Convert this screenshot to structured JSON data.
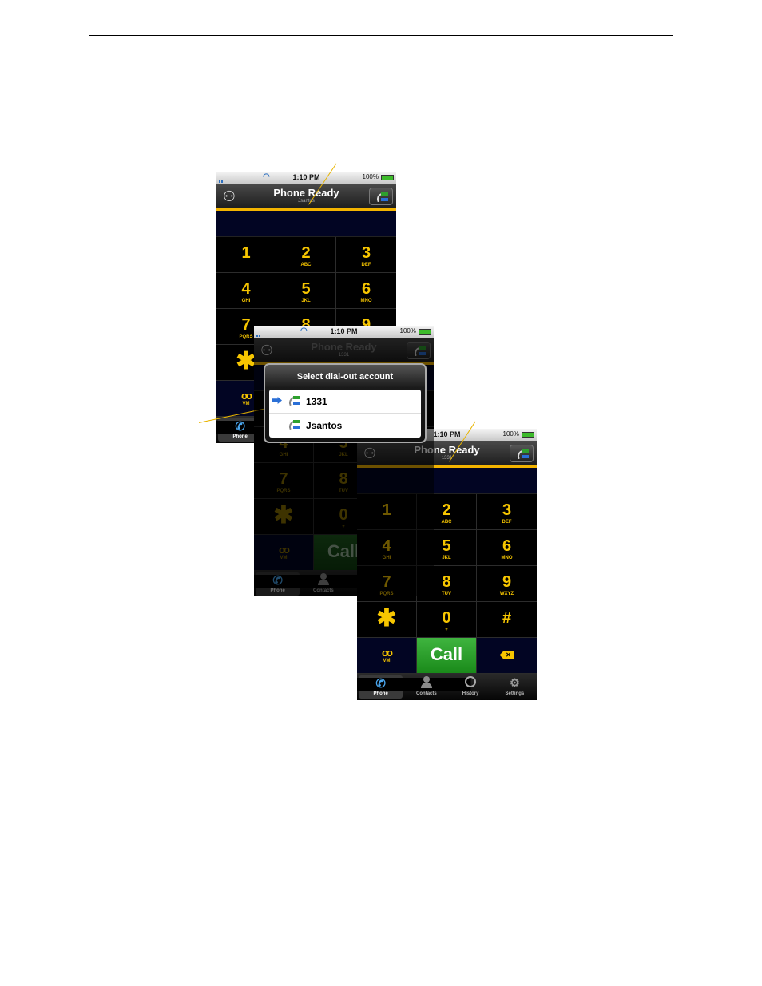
{
  "status_bar": {
    "time": "1:10 PM",
    "battery": "100%"
  },
  "app": {
    "title": "Phone Ready"
  },
  "screens": [
    {
      "id": "screen-a",
      "subtitle": "Jsantos"
    },
    {
      "id": "screen-b",
      "subtitle": "1331"
    },
    {
      "id": "screen-c",
      "subtitle": "1331"
    }
  ],
  "keypad": [
    {
      "digit": "1",
      "letters": ""
    },
    {
      "digit": "2",
      "letters": "ABC"
    },
    {
      "digit": "3",
      "letters": "DEF"
    },
    {
      "digit": "4",
      "letters": "GHI"
    },
    {
      "digit": "5",
      "letters": "JKL"
    },
    {
      "digit": "6",
      "letters": "MNO"
    },
    {
      "digit": "7",
      "letters": "PQRS"
    },
    {
      "digit": "8",
      "letters": "TUV"
    },
    {
      "digit": "9",
      "letters": "WXYZ"
    },
    {
      "digit": "✱",
      "letters": ""
    },
    {
      "digit": "0",
      "letters": "+"
    },
    {
      "digit": "#",
      "letters": ""
    }
  ],
  "function_row": {
    "voicemail_label": "VM",
    "call_label": "Call",
    "delete_icon": "backspace-icon"
  },
  "tabs": [
    {
      "label": "Phone",
      "icon": "phone-icon"
    },
    {
      "label": "Contacts",
      "icon": "person-icon"
    },
    {
      "label": "History",
      "icon": "clock-icon"
    },
    {
      "label": "Settings",
      "icon": "gear-icon"
    }
  ],
  "dialout_sheet": {
    "title": "Select dial-out account",
    "options": [
      {
        "label": "1331",
        "selected": true
      },
      {
        "label": "Jsantos",
        "selected": false
      }
    ]
  },
  "colors": {
    "accent": "#f2b300",
    "key_text": "#f7c600",
    "call_green": "#2a9a2a",
    "display_bg": "#020523"
  }
}
